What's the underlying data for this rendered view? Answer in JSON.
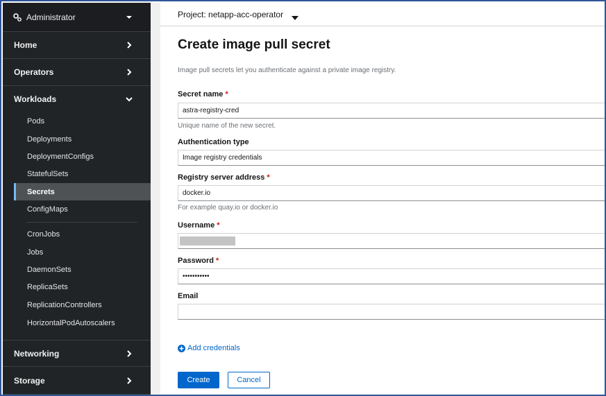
{
  "sidebar": {
    "perspective": {
      "label": "Administrator",
      "icon": "gear-icon"
    },
    "sections": {
      "home": "Home",
      "operators": "Operators",
      "workloads": "Workloads",
      "networking": "Networking",
      "storage": "Storage"
    },
    "workloads_items": [
      "Pods",
      "Deployments",
      "DeploymentConfigs",
      "StatefulSets",
      "Secrets",
      "ConfigMaps",
      "CronJobs",
      "Jobs",
      "DaemonSets",
      "ReplicaSets",
      "ReplicationControllers",
      "HorizontalPodAutoscalers"
    ],
    "active_item": "Secrets"
  },
  "project": {
    "label": "Project: netapp-acc-operator"
  },
  "page": {
    "title": "Create image pull secret",
    "description": "Image pull secrets let you authenticate against a private image registry."
  },
  "form": {
    "secret_name": {
      "label": "Secret name",
      "required": "*",
      "value": "astra-registry-cred",
      "helper": "Unique name of the new secret."
    },
    "auth_type": {
      "label": "Authentication type",
      "value": "Image registry credentials"
    },
    "registry": {
      "label": "Registry server address",
      "required": "*",
      "value": "docker.io",
      "helper": "For example quay.io or docker.io"
    },
    "username": {
      "label": "Username",
      "required": "*",
      "value": ""
    },
    "password": {
      "label": "Password",
      "required": "*",
      "value": "•••••••••••"
    },
    "email": {
      "label": "Email",
      "value": ""
    },
    "add_credentials": "Add credentials"
  },
  "actions": {
    "create": "Create",
    "cancel": "Cancel"
  },
  "colors": {
    "primary": "#0066cc",
    "sidebar_bg": "#212427",
    "required": "#c9190b",
    "active_accent": "#73bcf7"
  }
}
